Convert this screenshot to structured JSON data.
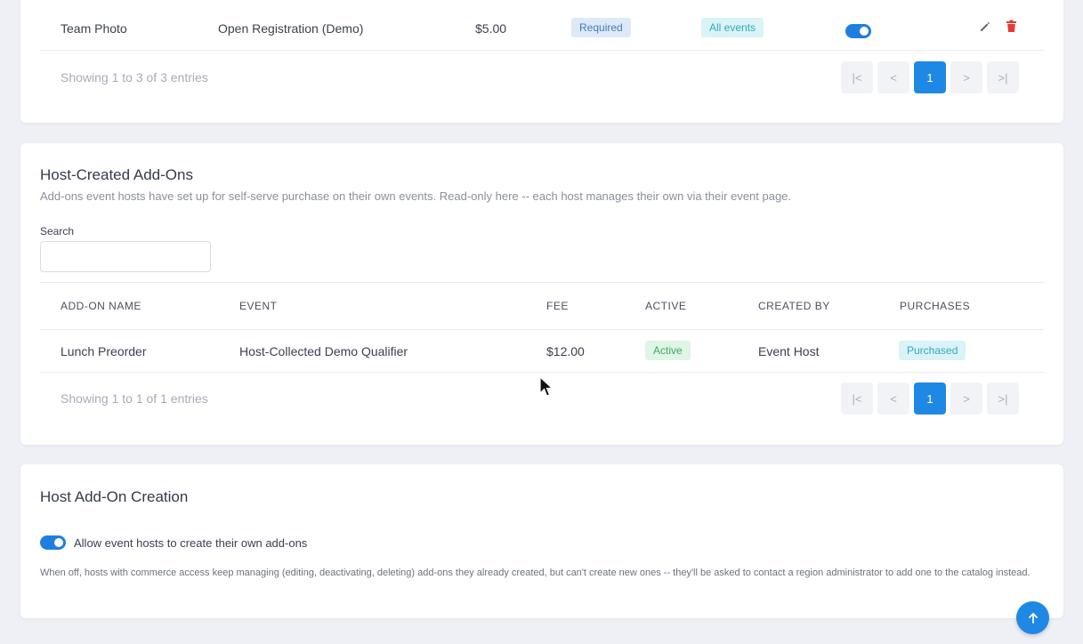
{
  "top_table": {
    "row": {
      "name": "Team Photo",
      "registration": "Open Registration (Demo)",
      "fee": "$5.00",
      "requirement": "Required",
      "scope": "All events",
      "active": true
    },
    "footer": "Showing 1 to 3 of 3 entries",
    "pagination": {
      "first": "|<",
      "prev": "<",
      "page": "1",
      "next": ">",
      "last": ">|"
    }
  },
  "host_addons": {
    "title": "Host-Created Add-Ons",
    "subtitle": "Add-ons event hosts have set up for self-serve purchase on their own events. Read-only here -- each host manages their own via their event page.",
    "search_label": "Search",
    "search_placeholder": "",
    "columns": [
      "ADD-ON NAME",
      "EVENT",
      "FEE",
      "ACTIVE",
      "CREATED BY",
      "PURCHASES"
    ],
    "rows": [
      {
        "name": "Lunch Preorder",
        "event": "Host-Collected Demo Qualifier",
        "fee": "$12.00",
        "active": "Active",
        "created_by": "Event Host",
        "purchases": "Purchased"
      }
    ],
    "footer": "Showing 1 to 1 of 1 entries",
    "pagination": {
      "first": "|<",
      "prev": "<",
      "page": "1",
      "next": ">",
      "last": ">|"
    }
  },
  "host_creation": {
    "title": "Host Add-On Creation",
    "toggle_label": "Allow event hosts to create their own add-ons",
    "toggle_on": true,
    "help_text": "When off, hosts with commerce access keep managing (editing, deactivating, deleting) add-ons they already created, but can't create new ones -- they'll be asked to contact a region administrator to add one to the catalog instead."
  },
  "colors": {
    "accent": "#1f88e5",
    "danger": "#e53935",
    "background": "#eef0f5"
  },
  "icons": [
    "pencil-icon",
    "trash-icon",
    "arrow-up-icon",
    "cursor-icon"
  ]
}
